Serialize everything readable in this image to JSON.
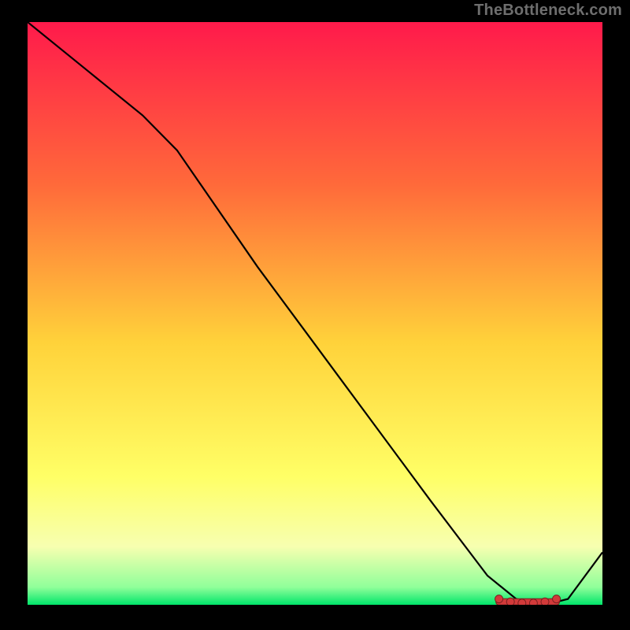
{
  "attribution": "TheBottleneck.com",
  "chart_data": {
    "type": "line",
    "title": "",
    "xlabel": "",
    "ylabel": "",
    "xlim": [
      0,
      100
    ],
    "ylim": [
      0,
      100
    ],
    "grid": false,
    "legend": false,
    "gradient_stops": [
      {
        "offset": 0,
        "color": "#ff1a4b"
      },
      {
        "offset": 28,
        "color": "#ff6a3a"
      },
      {
        "offset": 55,
        "color": "#ffd23a"
      },
      {
        "offset": 78,
        "color": "#ffff66"
      },
      {
        "offset": 90,
        "color": "#f7ffb0"
      },
      {
        "offset": 97,
        "color": "#8fff9a"
      },
      {
        "offset": 100,
        "color": "#00e56a"
      }
    ],
    "series": [
      {
        "name": "bottleneck-curve",
        "color": "#000000",
        "x": [
          0,
          10,
          20,
          26,
          40,
          55,
          70,
          80,
          85,
          90,
          94,
          100
        ],
        "y": [
          100,
          92,
          84,
          78,
          58,
          38,
          18,
          5,
          1,
          0,
          1,
          9
        ]
      }
    ],
    "markers": {
      "name": "recommended-region",
      "color": "#d23a3a",
      "border": "#7a1f1f",
      "x": [
        82,
        84,
        86,
        88,
        90,
        92
      ],
      "y": [
        1,
        0.5,
        0.3,
        0.3,
        0.5,
        1
      ]
    }
  }
}
